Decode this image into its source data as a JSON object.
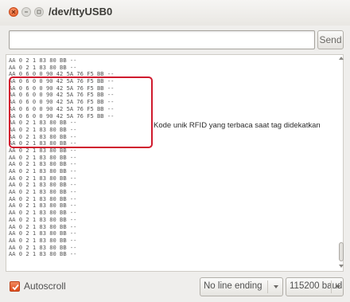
{
  "window": {
    "title": "/dev/ttyUSB0"
  },
  "input": {
    "value": "",
    "placeholder": ""
  },
  "send_button": {
    "label": "Send"
  },
  "serial_output": {
    "lines": [
      "AA 0 2 1 83 80 BB --",
      "AA 0 2 1 83 80 BB --",
      "AA 0 6 0 0 90 42 5A 76 F5 BB --",
      "AA 0 6 0 0 90 42 5A 76 F5 BB --",
      "AA 0 6 0 0 90 42 5A 76 F5 BB --",
      "AA 0 6 0 0 90 42 5A 76 F5 BB --",
      "AA 0 6 0 0 90 42 5A 76 F5 BB --",
      "AA 0 6 0 0 90 42 5A 76 F5 BB --",
      "AA 0 6 0 0 90 42 5A 76 F5 BB --",
      "AA 0 2 1 83 80 BB --",
      "AA 0 2 1 83 80 BB --",
      "AA 0 2 1 83 80 BB --",
      "AA 0 2 1 83 80 BB --",
      "AA 0 2 1 83 80 BB --",
      "AA 0 2 1 83 80 BB --",
      "AA 0 2 1 83 80 BB --",
      "AA 0 2 1 83 80 BB --",
      "AA 0 2 1 83 80 BB --",
      "AA 0 2 1 83 80 BB --",
      "AA 0 2 1 83 80 BB --",
      "AA 0 2 1 83 80 BB --",
      "AA 0 2 1 83 80 BB --",
      "AA 0 2 1 83 80 BB --",
      "AA 0 2 1 83 80 BB --",
      "AA 0 2 1 83 80 BB --",
      "AA 0 2 1 83 80 BB --",
      "AA 0 2 1 83 80 BB --",
      "AA 0 2 1 83 80 BB --",
      "AA 0 2 1 83 80 BB --"
    ],
    "annotation": "Kode unik RFID yang terbaca saat tag didekatkan",
    "highlight_color": "#d01a2e"
  },
  "footer": {
    "autoscroll_label": "Autoscroll",
    "autoscroll_checked": true,
    "line_ending": "No line ending",
    "baud_rate": "115200 baud"
  },
  "colors": {
    "accent": "#e2531d",
    "window_bg": "#efeeec"
  }
}
